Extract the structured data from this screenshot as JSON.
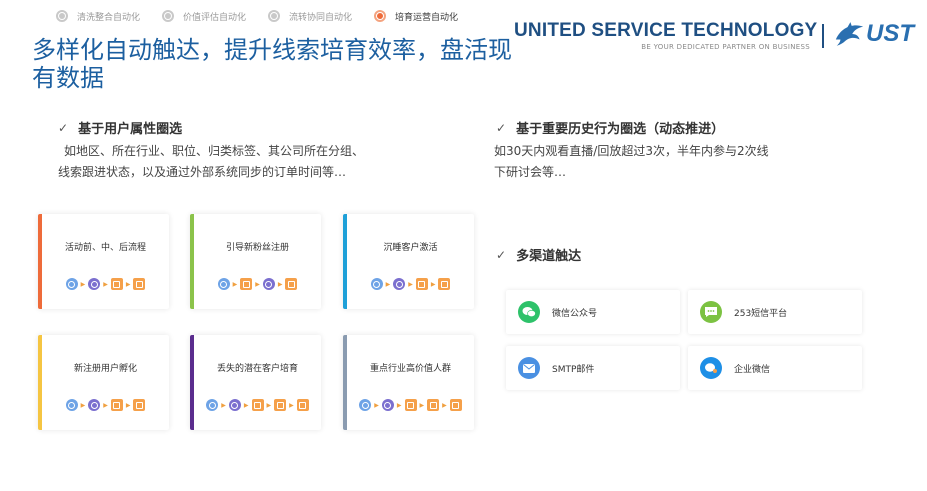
{
  "steps": [
    {
      "label": "清洗整合自动化",
      "active": false
    },
    {
      "label": "价值评估自动化",
      "active": false
    },
    {
      "label": "流转协同自动化",
      "active": false
    },
    {
      "label": "培育运营自动化",
      "active": true
    }
  ],
  "title": "多样化自动触达，提升线索培育效率，盘活现有数据",
  "brand": {
    "name_part1": "UNITED SERVICE",
    "name_part2": "TECHNOLOGY",
    "tagline": "BE YOUR DEDICATED PARTNER ON BUSINESS",
    "logo_text": "UST",
    "logo_icon": "dolphin-icon",
    "color": "#1f4f82"
  },
  "features": {
    "attr": {
      "heading": "基于用户属性圈选",
      "body_line1": "如地区、所在行业、职位、归类标签、其公司所在分组、",
      "body_line2": "线索跟进状态，以及通过外部系统同步的订单时间等…"
    },
    "history": {
      "heading": "基于重要历史行为圈选（动态推进）",
      "body_line1": "如30天内观看直播/回放超过3次，半年内参与2次线",
      "body_line2": "下研讨会等…"
    },
    "multichannel": {
      "heading": "多渠道触达"
    },
    "check_glyph": "✓"
  },
  "cards": [
    {
      "title": "活动前、中、后流程",
      "accent": "#ee6b3a"
    },
    {
      "title": "引导新粉丝注册",
      "accent": "#8bc34a"
    },
    {
      "title": "沉睡客户激活",
      "accent": "#1ea0d8"
    },
    {
      "title": "新注册用户孵化",
      "accent": "#f5c542"
    },
    {
      "title": "丢失的潜在客户培育",
      "accent": "#5b2d8e"
    },
    {
      "title": "重点行业高价值人群",
      "accent": "#8a9bb0"
    }
  ],
  "channels": [
    {
      "label": "微信公众号",
      "icon": "wechat-icon",
      "color": "#2ec26a"
    },
    {
      "label": "253短信平台",
      "icon": "sms-icon",
      "color": "#7cc242"
    },
    {
      "label": "SMTP邮件",
      "icon": "mail-icon",
      "color": "#4a90e2"
    },
    {
      "label": "企业微信",
      "icon": "work-wechat-icon",
      "color": "#1e8fe6"
    }
  ]
}
